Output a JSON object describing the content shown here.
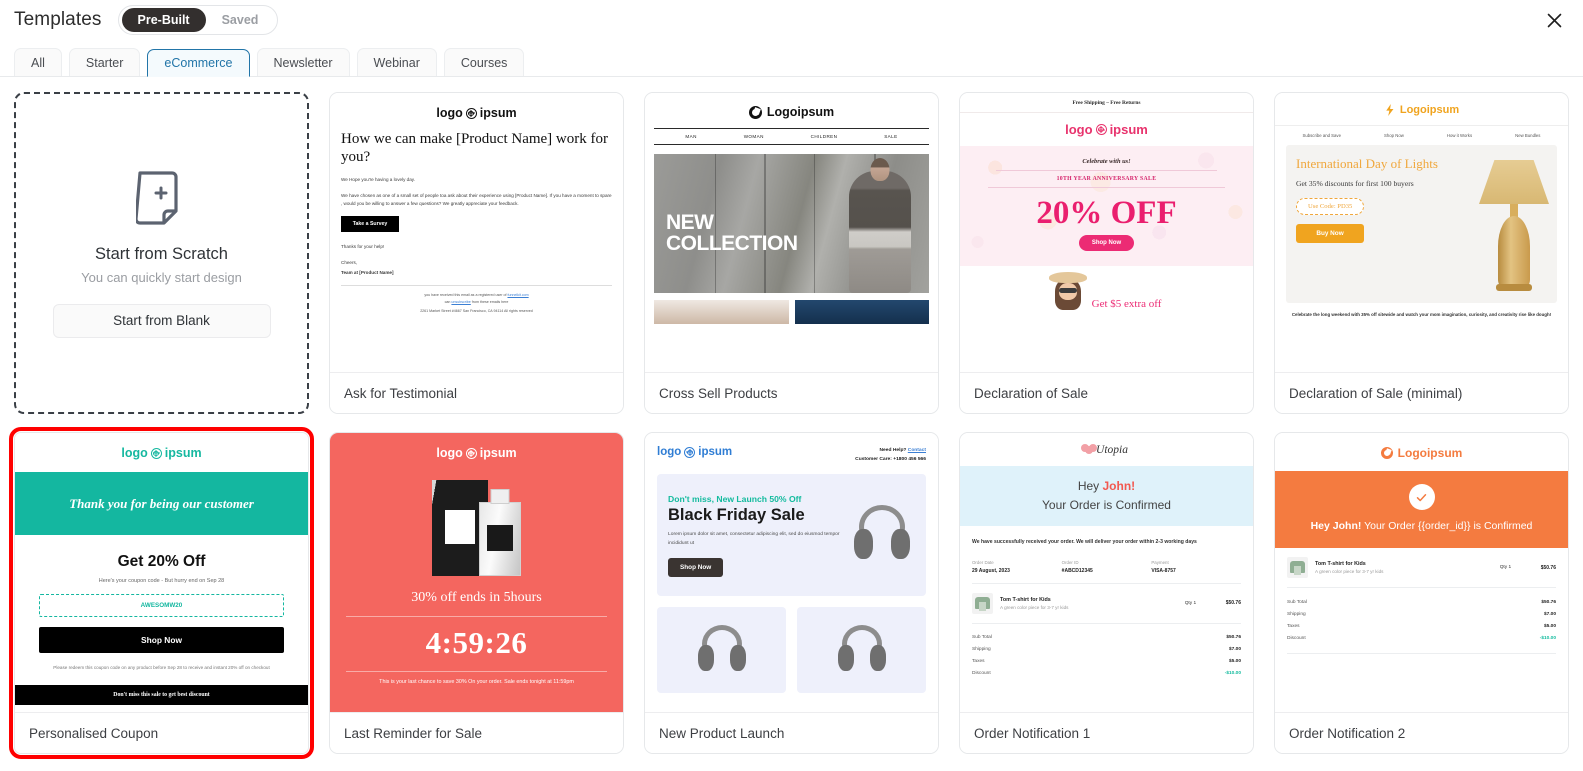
{
  "header": {
    "title": "Templates",
    "segments": [
      {
        "label": "Pre-Built",
        "active": true
      },
      {
        "label": "Saved",
        "active": false
      }
    ],
    "close_icon": "close-icon"
  },
  "filters": [
    {
      "label": "All",
      "active": false
    },
    {
      "label": "Starter",
      "active": false
    },
    {
      "label": "eCommerce",
      "active": true
    },
    {
      "label": "Newsletter",
      "active": false
    },
    {
      "label": "Webinar",
      "active": false
    },
    {
      "label": "Courses",
      "active": false
    }
  ],
  "colors": {
    "accent_blue": "#2275a8",
    "selected_border": "#ff0000",
    "teal": "#14b7a0",
    "pink": "#ec2b74",
    "orange": "#f47b40",
    "amber": "#f0a41f",
    "coral": "#f4665f"
  },
  "scratch_card": {
    "icon": "document-plus-icon",
    "title": "Start from Scratch",
    "subtitle": "You can quickly start design",
    "button": "Start from Blank"
  },
  "templates": [
    {
      "id": "ask-for-testimonial",
      "label": "Ask for Testimonial",
      "selected": false,
      "preview": {
        "logo": "logo ipsum",
        "heading": "How we can make [Product Name] work for you?",
        "paragraphs": [
          "We Hope you're having a lovely day.",
          "We have chosen as one of a small set of people toa ask about their experience using [Product Name]. If you have a moment to spare , would you be willing to answer a few questions? We greatly appreciate your feedback."
        ],
        "button": "Take a Survey",
        "thanks": "Thanks for your help!",
        "sign_off": "Cheers,",
        "team": "Team at [Product Name]",
        "footer_line1_a": "you have received this email as a registered user of ",
        "footer_link1": "funnelkit.com",
        "footer_line2_a": "can ",
        "footer_link2": "unsubscribe",
        "footer_line2_b": " from these emails here",
        "footer_address": "2261 Market Street #4667 San Francisco, CA 94114 All rights reserved"
      }
    },
    {
      "id": "cross-sell-products",
      "label": "Cross Sell Products",
      "selected": false,
      "preview": {
        "logo": "Logoipsum",
        "nav": [
          "MAN",
          "WOMAN",
          "CHILDREN",
          "SALE"
        ],
        "hero_line1": "NEW",
        "hero_line2": "COLLECTION"
      }
    },
    {
      "id": "declaration-of-sale",
      "label": "Declaration of Sale",
      "selected": false,
      "preview": {
        "top_bar": "Free Shipping  –  Free Returns",
        "logo": "logo ipsum",
        "celebrate": "Celebrate with us!",
        "anniversary": "10TH YEAR ANNIVERSARY SALE",
        "big": "20% OFF",
        "button": "Shop Now",
        "extra": "Get $5 extra off"
      }
    },
    {
      "id": "declaration-of-sale-minimal",
      "label": "Declaration of Sale (minimal)",
      "selected": false,
      "preview": {
        "logo": "Logoipsum",
        "nav": [
          "Subscribe and Save",
          "Shop Now",
          "How it Works",
          "New Bundles"
        ],
        "heading": "International Day of Lights",
        "sub": "Get 35% discounts for first 100 buyers",
        "code": "Use Code: PD35",
        "button": "Buy Now",
        "caption": "Celebrate the long weekend with 35% off sitewide and watch your mom imagination, curiosity, and creativity rise like dough!"
      }
    },
    {
      "id": "personalised-coupon",
      "label": "Personalised Coupon",
      "selected": true,
      "preview": {
        "logo": "logo ipsum",
        "banner": "Thank you for being our customer",
        "heading": "Get 20% Off",
        "sub": "Here's your coupon code - But hurry end on  Sep 28",
        "code": "AWESOMW20",
        "button": "Shop Now",
        "note": "Please redeem this coupon code on any product before Sep 28 to receive and instant 20% off on checkout",
        "footer": "Don't miss this sale to get best discount"
      }
    },
    {
      "id": "last-reminder-for-sale",
      "label": "Last Reminder for Sale",
      "selected": false,
      "preview": {
        "logo": "logo ipsum",
        "heading": "30% off ends in 5hours",
        "timer": "4:59:26",
        "note": "This is your last chance to save 30% On your order. Sale ends tonight at 11:59pm"
      }
    },
    {
      "id": "new-product-launch",
      "label": "New Product Launch",
      "selected": false,
      "preview": {
        "logo": "logo ipsum",
        "help_prefix": "Need Help? ",
        "help_link": "Contact",
        "care": "Customer Care: +1800 456 566",
        "kicker": "Don't miss, New Launch 50% Off",
        "heading": "Black Friday Sale",
        "body": "Lorem ipsum dolor sit amet, consectetur adipiscing elit, sed do eiusmod tempor incididunt ut",
        "button": "Shop Now"
      }
    },
    {
      "id": "order-notification-1",
      "label": "Order Notification 1",
      "selected": false,
      "preview": {
        "logo": "Utopia",
        "hey_prefix": "Hey ",
        "hey_name": "John!",
        "confirmed": "Your Order is Confirmed",
        "body": "We have successfully received your order. We will deliver your order within 2-3 working days",
        "meta": [
          {
            "key": "Order Date",
            "value": "29 August, 2023"
          },
          {
            "key": "Order ID",
            "value": "#ABCD12345"
          },
          {
            "key": "Payment",
            "value": "VISA-8757"
          }
        ],
        "item_name": "Tom T-shirt for Kids",
        "item_desc": "A green color piece for 3-7 yr kids",
        "item_qty": "Qty 1",
        "item_price": "$50.76",
        "totals": [
          {
            "key": "Sub Total",
            "value": "$50.76"
          },
          {
            "key": "Shipping",
            "value": "$7.00"
          },
          {
            "key": "Taxes",
            "value": "$5.00"
          },
          {
            "key": "Discount",
            "value": "-$10.00"
          }
        ]
      }
    },
    {
      "id": "order-notification-2",
      "label": "Order Notification 2",
      "selected": false,
      "preview": {
        "logo": "Logoipsum",
        "check_icon": "check-circle-icon",
        "hey": "Hey John!",
        "rest": " Your Order {{order_id}} is Confirmed",
        "item_name": "Tom T-shirt for Kids",
        "item_desc": "A green color piece for 3-7 yr kids",
        "item_qty": "Qty 1",
        "item_price": "$50.76",
        "totals": [
          {
            "key": "Sub Total",
            "value": "$50.76"
          },
          {
            "key": "Shipping",
            "value": "$7.00"
          },
          {
            "key": "Taxes",
            "value": "$5.00"
          },
          {
            "key": "Discount",
            "value": "-$10.00"
          }
        ]
      }
    }
  ]
}
